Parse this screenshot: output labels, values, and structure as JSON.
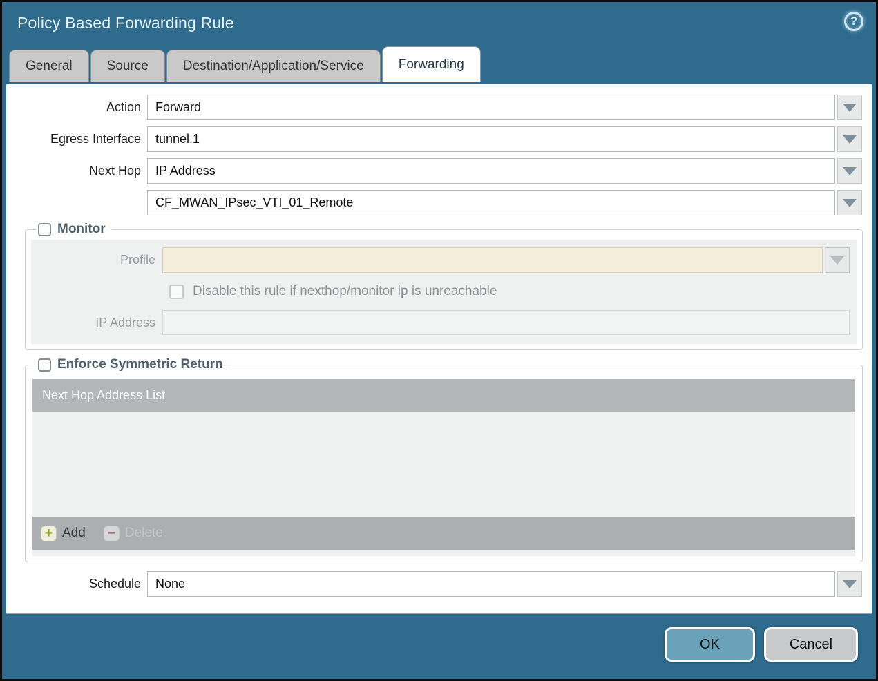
{
  "window": {
    "title": "Policy Based Forwarding Rule",
    "help_glyph": "?"
  },
  "tabs": [
    {
      "label": "General",
      "active": false
    },
    {
      "label": "Source",
      "active": false
    },
    {
      "label": "Destination/Application/Service",
      "active": false
    },
    {
      "label": "Forwarding",
      "active": true
    }
  ],
  "form": {
    "action": {
      "label": "Action",
      "value": "Forward"
    },
    "egress_interface": {
      "label": "Egress Interface",
      "value": "tunnel.1"
    },
    "next_hop": {
      "label": "Next Hop",
      "value": "IP Address"
    },
    "next_hop_address": {
      "value": "CF_MWAN_IPsec_VTI_01_Remote"
    },
    "schedule": {
      "label": "Schedule",
      "value": "None"
    }
  },
  "monitor": {
    "legend": "Monitor",
    "checked": false,
    "profile": {
      "label": "Profile",
      "value": ""
    },
    "disable_rule_checkbox": {
      "label": "Disable this rule if nexthop/monitor ip is unreachable",
      "checked": false
    },
    "ip_address": {
      "label": "IP Address",
      "value": ""
    }
  },
  "enforce_symmetric_return": {
    "legend": "Enforce Symmetric Return",
    "checked": false,
    "table": {
      "header": "Next Hop Address List",
      "rows": []
    },
    "add_button": {
      "label": "Add",
      "glyph": "+",
      "enabled": true
    },
    "delete_button": {
      "label": "Delete",
      "glyph": "−",
      "enabled": false
    }
  },
  "footer": {
    "ok_label": "OK",
    "cancel_label": "Cancel"
  },
  "colors": {
    "titlebar": "#2e6b8c",
    "tab_inactive": "#c9c9c9",
    "tab_active": "#ffffff",
    "legend_text": "#4c5f6b",
    "disabled_field_cream": "#f5eedd",
    "table_header": "#b3b7ba",
    "table_footer": "#abafb2",
    "ok_button": "#69a2b9",
    "cancel_button": "#c9cacb",
    "add_plus": "#8fa120",
    "delete_minus": "#8d4a4a"
  }
}
